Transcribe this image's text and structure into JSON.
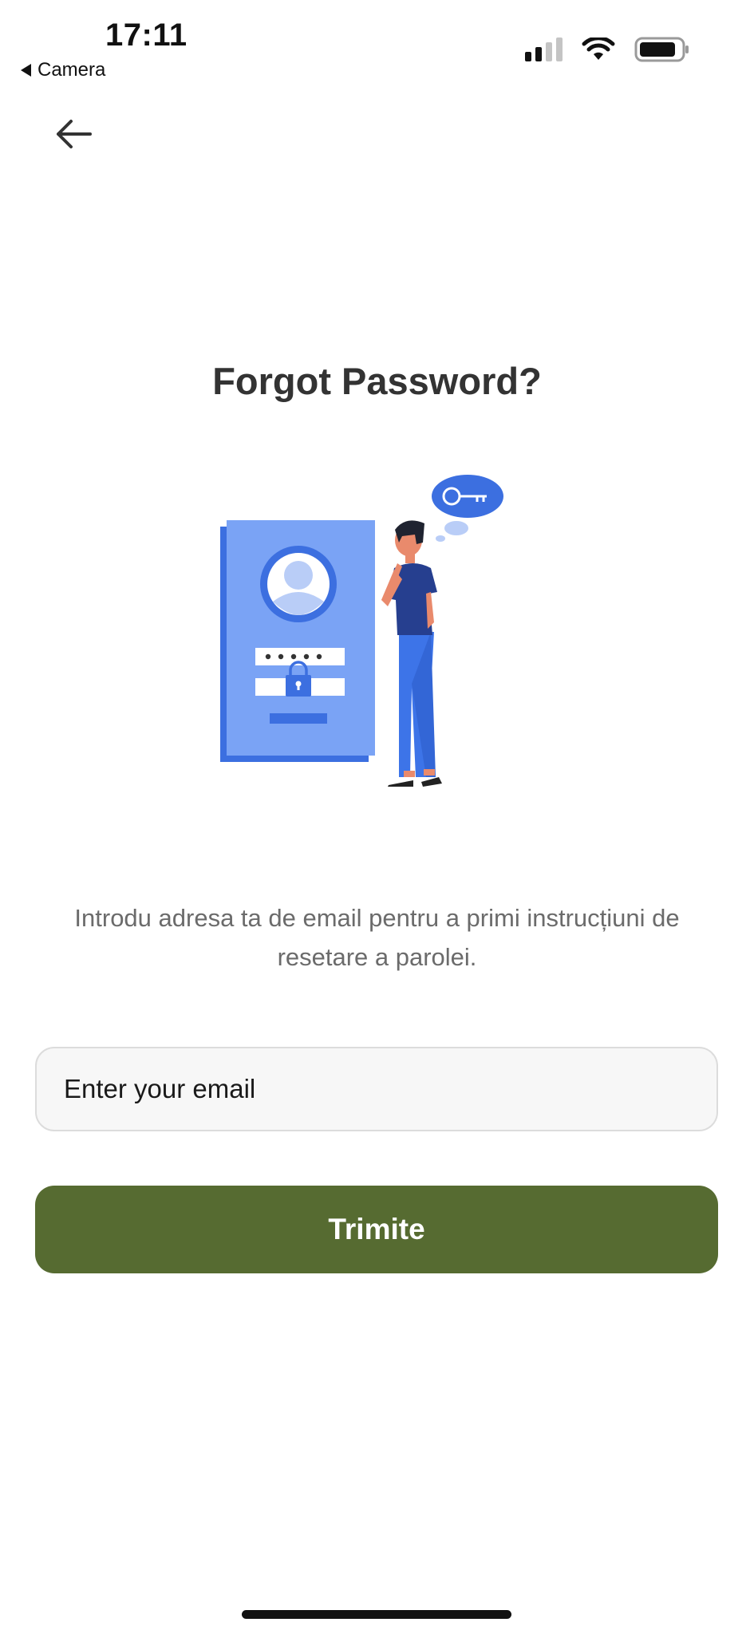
{
  "status_bar": {
    "time": "17:11",
    "back_to_app": "Camera",
    "icons": [
      "cellular-signal-icon",
      "wifi-icon",
      "battery-icon"
    ]
  },
  "nav": {
    "back_icon": "arrow-left-icon"
  },
  "page": {
    "title": "Forgot Password?",
    "description": "Introdu adresa ta de email pentru a primi instrucțiuni de resetare a parolei."
  },
  "illustration": {
    "subject": "forgot-password-illustration",
    "password_mask": "•••••"
  },
  "form": {
    "email_value": "",
    "email_placeholder": "Enter your email",
    "submit_label": "Trimite"
  },
  "colors": {
    "primary_button": "#566b31",
    "illustration_blue": "#5b8def",
    "illustration_dark_blue": "#2a4594",
    "title_text": "#333333",
    "description_text": "#6b6b6b"
  }
}
